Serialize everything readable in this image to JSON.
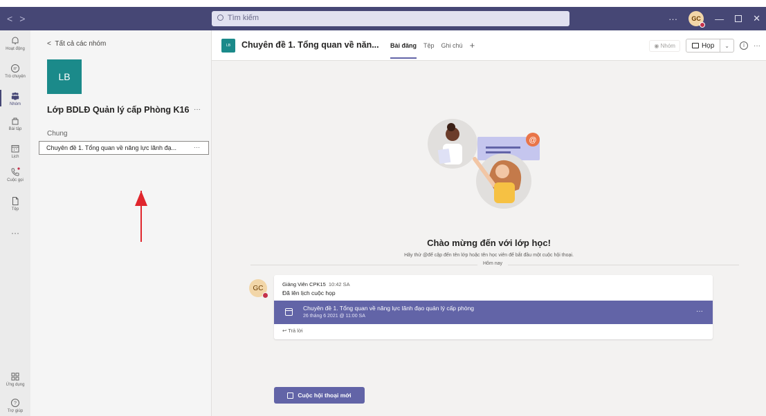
{
  "titlebar": {
    "search_placeholder": "Tìm kiếm",
    "avatar_initials": "GC",
    "more": "···"
  },
  "rail": {
    "items": [
      {
        "label": "Hoạt động"
      },
      {
        "label": "Trò chuyện"
      },
      {
        "label": "Nhóm"
      },
      {
        "label": "Bài tập"
      },
      {
        "label": "Lịch"
      },
      {
        "label": "Cuộc gọi"
      },
      {
        "label": "Tệp"
      }
    ],
    "more": "···",
    "bottom": [
      {
        "label": "Ứng dụng"
      },
      {
        "label": "Trợ giúp"
      }
    ]
  },
  "panel": {
    "back": "Tất cả các nhóm",
    "team_initials": "LB",
    "team_name": "Lớp BDLĐ Quản lý cấp Phòng K16",
    "team_more": "···",
    "section": "Chung",
    "channel": "Chuyên đề 1. Tổng quan về năng lực lãnh đạ...",
    "channel_more": "···"
  },
  "header": {
    "channel_initials": "LB",
    "title": "Chuyên đề 1. Tổng quan về năn...",
    "tabs": [
      {
        "label": "Bài đăng"
      },
      {
        "label": "Tệp"
      },
      {
        "label": "Ghi chú"
      }
    ],
    "add_tab": "+",
    "team_btn": "Nhóm",
    "meet_label": "Họp",
    "more": "···"
  },
  "content": {
    "welcome": "Chào mừng đến với lớp học!",
    "hint": "Hãy thử @để cập đến tên lớp hoặc tên học viên để bắt đầu một cuộc hội thoại.",
    "divider": "Hôm nay",
    "post": {
      "avatar": "GC",
      "author": "Giảng Viên CPK15",
      "time": "10:42 SA",
      "text": "Đã lên lịch cuộc họp",
      "meeting_title": "Chuyên đề 1. Tổng quan về năng lực lãnh đạo quản lý cấp phòng",
      "meeting_date": "26 tháng 6 2021 @ 11:00 SA",
      "meeting_more": "···",
      "reply": "Trả lời"
    },
    "new_conversation": "Cuộc hội thoại mới"
  },
  "colors": {
    "titlebar": "#464775",
    "accent": "#6264a7",
    "team_logo": "#1b8a8a",
    "arrow": "#e0262d"
  }
}
